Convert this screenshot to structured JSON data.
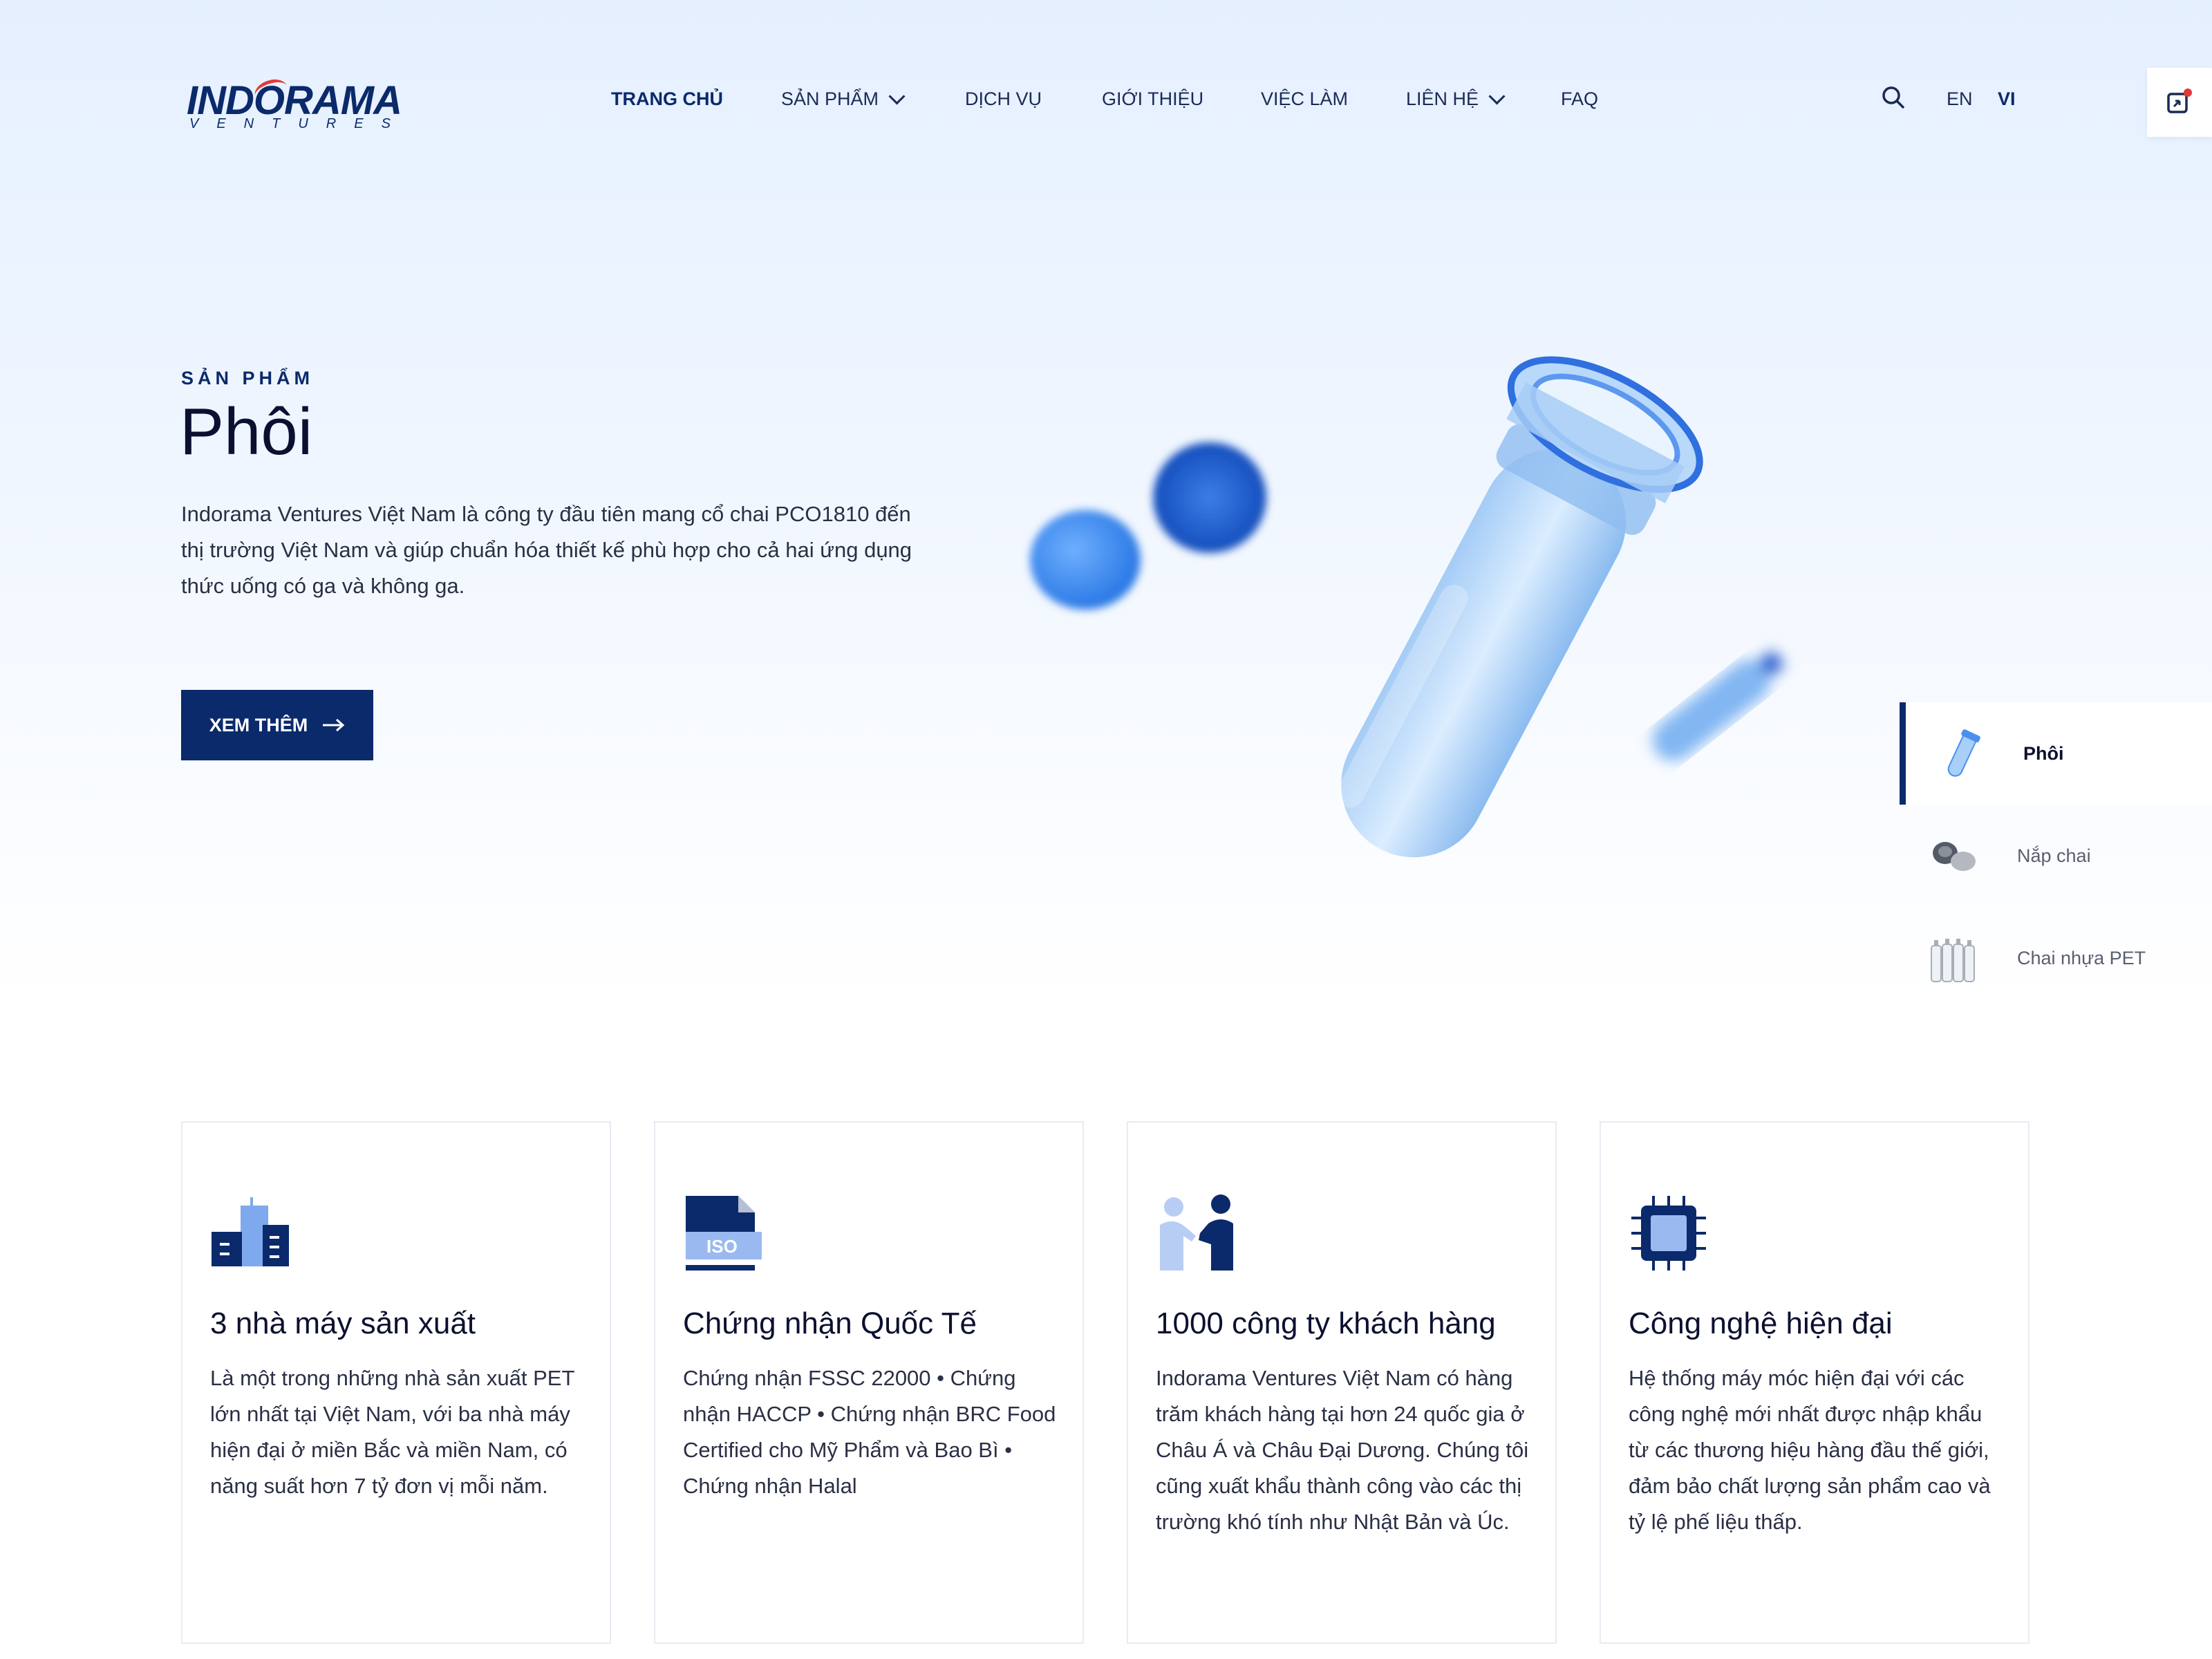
{
  "brand": {
    "name": "INDORAMA",
    "tagline": "VENTURES"
  },
  "colors": {
    "primary": "#0b2a6b",
    "accent": "#e23a3a",
    "light_blue": "#4a8ff0"
  },
  "nav": {
    "items": [
      {
        "label": "TRANG CHỦ",
        "active": true,
        "dropdown": false
      },
      {
        "label": "SẢN PHẨM",
        "active": false,
        "dropdown": true
      },
      {
        "label": "DỊCH VỤ",
        "active": false,
        "dropdown": false
      },
      {
        "label": "GIỚI THIỆU",
        "active": false,
        "dropdown": false
      },
      {
        "label": "VIỆC LÀM",
        "active": false,
        "dropdown": false
      },
      {
        "label": "LIÊN HỆ",
        "active": false,
        "dropdown": true
      },
      {
        "label": "FAQ",
        "active": false,
        "dropdown": false
      }
    ],
    "search_icon": "search-icon",
    "languages": [
      {
        "code": "EN",
        "active": false
      },
      {
        "code": "VI",
        "active": true
      }
    ],
    "side_tab_icon": "notification-icon"
  },
  "hero": {
    "eyebrow": "SẢN PHẨM",
    "title": "Phôi",
    "description": "Indorama Ventures Việt Nam là công ty đầu tiên mang cổ chai PCO1810 đến thị trường Việt Nam và giúp chuẩn hóa thiết kế phù hợp cho cả hai ứng dụng thức uống có ga và không ga.",
    "cta_label": "XEM THÊM",
    "cta_icon": "arrow-right-icon"
  },
  "product_selector": {
    "items": [
      {
        "label": "Phôi",
        "active": true,
        "icon": "preform-icon"
      },
      {
        "label": "Nắp chai",
        "active": false,
        "icon": "bottle-cap-icon"
      },
      {
        "label": "Chai nhựa PET",
        "active": false,
        "icon": "pet-bottles-icon"
      }
    ]
  },
  "features": [
    {
      "icon": "factory-icon",
      "title": "3 nhà máy sản xuất",
      "text": "Là một trong những nhà sản xuất PET lớn nhất tại Việt Nam, với ba nhà máy hiện đại ở miền Bắc và miền Nam, có năng suất hơn 7 tỷ đơn vị mỗi năm."
    },
    {
      "icon": "iso-certificate-icon",
      "title": "Chứng nhận Quốc Tế",
      "text": "Chứng nhận FSSC 22000 • Chứng nhận HACCP • Chứng nhận BRC Food Certified cho Mỹ Phẩm và Bao Bì • Chứng nhận Halal"
    },
    {
      "icon": "handshake-icon",
      "title": "1000 công ty khách hàng",
      "text": "Indorama Ventures Việt Nam có hàng trăm khách hàng tại hơn 24 quốc gia ở Châu Á và Châu Đại Dương. Chúng tôi cũng xuất khẩu thành công vào các thị trường khó tính như Nhật Bản và Úc."
    },
    {
      "icon": "chip-icon",
      "title": "Công nghệ hiện đại",
      "text": "Hệ thống máy móc hiện đại với các công nghệ mới nhất được nhập khẩu từ các thương hiệu hàng đầu thế giới, đảm bảo chất lượng sản phẩm cao và tỷ lệ phế liệu thấp."
    }
  ]
}
